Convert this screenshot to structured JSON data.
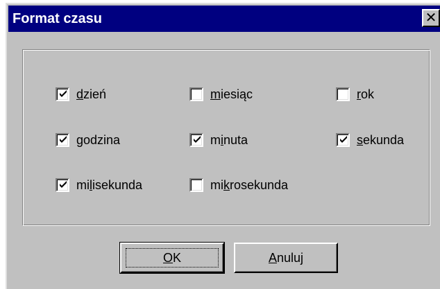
{
  "window": {
    "title": "Format czasu",
    "close_glyph": "✕"
  },
  "options": [
    {
      "pre": "",
      "key": "d",
      "post": "zień",
      "checked": true
    },
    {
      "pre": "",
      "key": "m",
      "post": "iesiąc",
      "checked": false
    },
    {
      "pre": "",
      "key": "r",
      "post": "ok",
      "checked": false
    },
    {
      "pre": "",
      "key": "g",
      "post": "odzina",
      "checked": true
    },
    {
      "pre": "m",
      "key": "i",
      "post": "nuta",
      "checked": true
    },
    {
      "pre": "",
      "key": "s",
      "post": "ekunda",
      "checked": true
    },
    {
      "pre": "mi",
      "key": "l",
      "post": "isekunda",
      "checked": true
    },
    {
      "pre": "mi",
      "key": "k",
      "post": "rosekunda",
      "checked": false
    }
  ],
  "buttons": {
    "ok": {
      "key": "O",
      "post": "K"
    },
    "cancel": {
      "key": "A",
      "post": "nuluj"
    }
  },
  "colors": {
    "titlebar": "#000080",
    "face": "#c0c0c0"
  }
}
